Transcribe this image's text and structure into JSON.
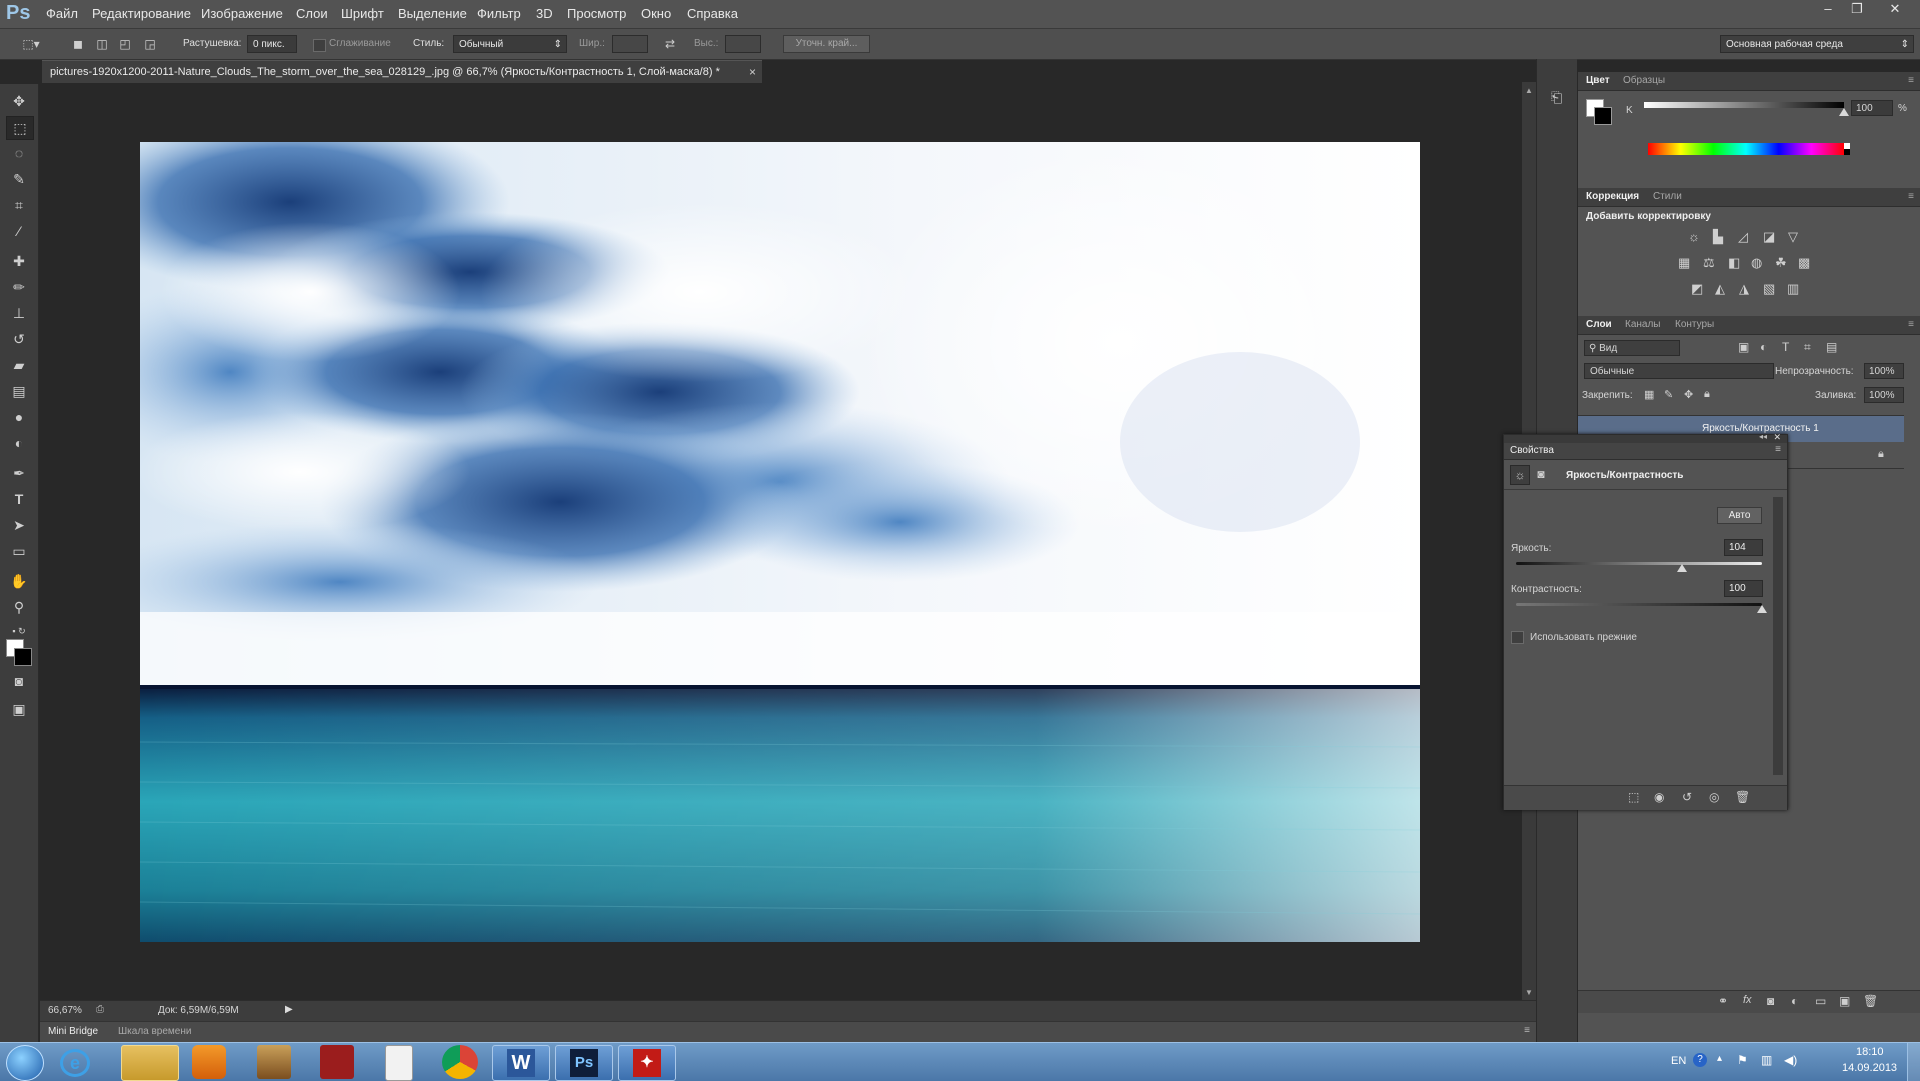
{
  "app": {
    "logo": "Ps"
  },
  "menu": [
    "Файл",
    "Редактирование",
    "Изображение",
    "Слои",
    "Шрифт",
    "Выделение",
    "Фильтр",
    "3D",
    "Просмотр",
    "Окно",
    "Справка"
  ],
  "window_controls": {
    "minimize": "–",
    "restore": "❐",
    "close": "✕"
  },
  "options_bar": {
    "feather_label": "Растушевка:",
    "feather_value": "0 пикс.",
    "antialias_label": "Сглаживание",
    "style_label": "Стиль:",
    "style_value": "Обычный",
    "width_label": "Шир.:",
    "height_label": "Выс.:",
    "refine_edge": "Уточн. край...",
    "workspace": "Основная рабочая среда"
  },
  "document": {
    "tab_title": "pictures-1920x1200-2011-Nature_Clouds_The_storm_over_the_sea_028129_.jpg @ 66,7% (Яркость/Контрастность 1, Слой-маска/8) *",
    "tab_close": "×",
    "zoom": "66,67%",
    "doc_size": "Док: 6,59M/6,59M"
  },
  "bottom_tabs": [
    "Mini Bridge",
    "Шкала времени"
  ],
  "color_panel": {
    "tabs": [
      "Цвет",
      "Образцы"
    ],
    "channel_label": "K",
    "channel_value": "100",
    "unit": "%"
  },
  "adjustments_panel": {
    "tabs": [
      "Коррекция",
      "Стили"
    ],
    "heading": "Добавить корректировку"
  },
  "layers_panel": {
    "tabs": [
      "Слои",
      "Каналы",
      "Контуры"
    ],
    "filter_kind": "Вид",
    "blend_mode": "Обычные",
    "opacity_label": "Непрозрачность:",
    "opacity_value": "100%",
    "lock_label": "Закрепить:",
    "fill_label": "Заливка:",
    "fill_value": "100%",
    "layer_name": "Яркость/Контрастность 1"
  },
  "properties_panel": {
    "title": "Свойства",
    "adjustment_name": "Яркость/Контрастность",
    "auto_button": "Авто",
    "brightness_label": "Яркость:",
    "brightness_value": "104",
    "contrast_label": "Контрастность:",
    "contrast_value": "100",
    "legacy_label": "Использовать прежние",
    "brightness_level": 0.6733,
    "contrast_level": 1.0
  },
  "taskbar": {
    "language": "EN",
    "time": "18:10",
    "date": "14.09.2013"
  },
  "colors": {
    "ui_dark": "#282828",
    "panel": "#535353",
    "accent_ps": "#9ec7e8",
    "taskbar": "#4b77a8"
  }
}
